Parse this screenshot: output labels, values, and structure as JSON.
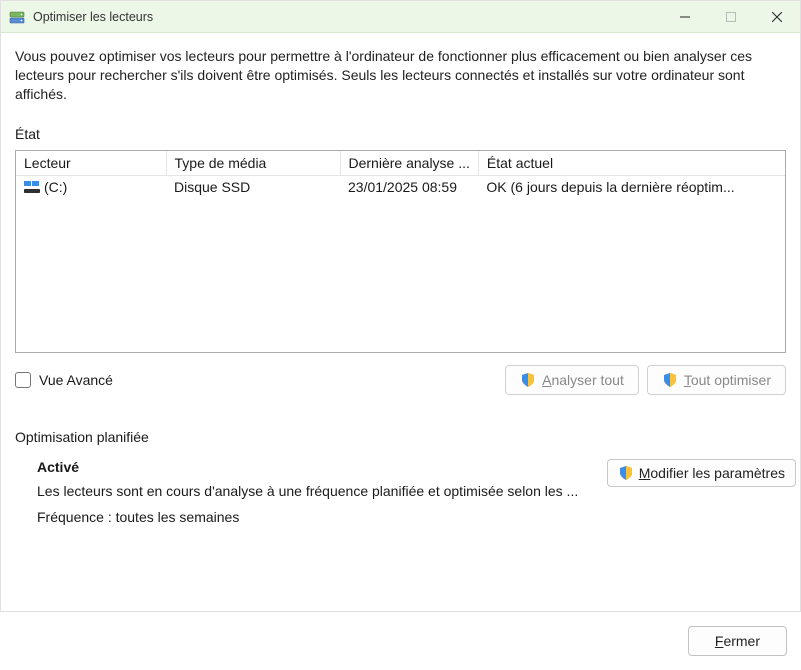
{
  "titlebar": {
    "title": "Optimiser les lecteurs"
  },
  "description": "Vous pouvez optimiser vos lecteurs pour permettre à l'ordinateur de fonctionner plus efficacement ou bien analyser ces lecteurs pour rechercher s'ils doivent être optimisés. Seuls les lecteurs connectés et installés sur votre ordinateur sont affichés.",
  "status_label": "État",
  "table": {
    "headers": {
      "drive": "Lecteur",
      "media": "Type de média",
      "last_analysis": "Dernière analyse ...",
      "current_state": "État actuel"
    },
    "rows": [
      {
        "name": "(C:)",
        "media": "Disque SSD",
        "last_analysis": "23/01/2025 08:59",
        "state": "OK (6 jours depuis la dernière réoptim..."
      }
    ]
  },
  "advanced_view_label": "Vue Avancé",
  "buttons": {
    "analyze_all_prefix": "A",
    "analyze_all_rest": "nalyser tout",
    "optimize_all_prefix": "T",
    "optimize_all_rest": "out optimiser",
    "modify_prefix": "M",
    "modify_rest": "odifier les paramètres",
    "close_prefix": "F",
    "close_rest": "ermer"
  },
  "scheduled": {
    "heading": "Optimisation planifiée",
    "status": "Activé",
    "description": "Les lecteurs sont en cours d'analyse à une fréquence planifiée et optimisée selon les ...",
    "frequency": "Fréquence : toutes les semaines"
  }
}
